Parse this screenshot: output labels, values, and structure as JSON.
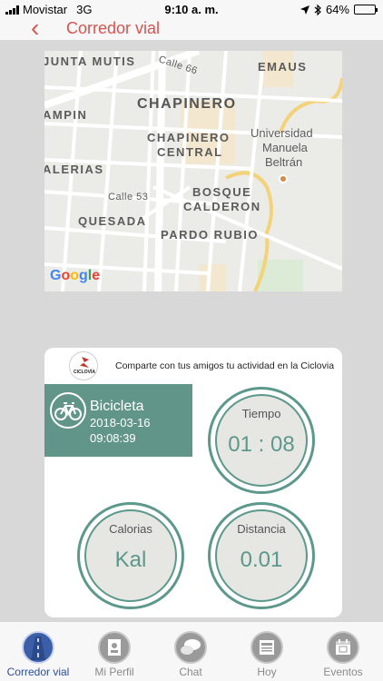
{
  "status_bar": {
    "carrier": "Movistar",
    "network": "3G",
    "time": "9:10 a. m.",
    "battery": "64%",
    "battery_level": 0.64
  },
  "nav": {
    "back_icon": "chevron-left-icon",
    "title": "Corredor vial",
    "accent_color": "#d9534f"
  },
  "map": {
    "labels": {
      "junta_mutis": "JUNTA MUTIS",
      "calle66": "Calle 66",
      "emaus": "EMAUS",
      "chapinero": "CHAPINERO",
      "ampin": "AMPIN",
      "chapinero_central_1": "CHAPINERO",
      "chapinero_central_2": "CENTRAL",
      "universidad_1": "Universidad",
      "universidad_2": "Manuela",
      "universidad_3": "Beltrán",
      "alerias": "ALERIAS",
      "calle53": "Calle 53",
      "bosque_1": "BOSQUE",
      "bosque_2": "CALDERON",
      "quesada": "QUESADA",
      "pardo_rubio": "PARDO RUBIO"
    },
    "attribution": "Google"
  },
  "card": {
    "logo_caption": "CICLOVÍA",
    "share_text": "Comparte con tus amigos tu actividad en la Ciclovia",
    "activity": {
      "icon": "bicycle-icon",
      "name": "Bicicleta",
      "date": "2018-03-16",
      "time": "09:08:39",
      "color": "#62958a"
    },
    "stats": {
      "tiempo": {
        "label": "Tiempo",
        "value": "01 : 08"
      },
      "calorias": {
        "label": "Calorias",
        "value": "Kal"
      },
      "distancia": {
        "label": "Distancia",
        "value": "0.01"
      }
    }
  },
  "tabs": [
    {
      "label": "Corredor vial",
      "icon": "road-icon",
      "active": true
    },
    {
      "label": "Mi Perfil",
      "icon": "profile-card-icon",
      "active": false
    },
    {
      "label": "Chat",
      "icon": "chat-bubble-icon",
      "active": false
    },
    {
      "label": "Hoy",
      "icon": "newspaper-icon",
      "active": false
    },
    {
      "label": "Eventos",
      "icon": "calendar-icon",
      "active": false
    }
  ]
}
